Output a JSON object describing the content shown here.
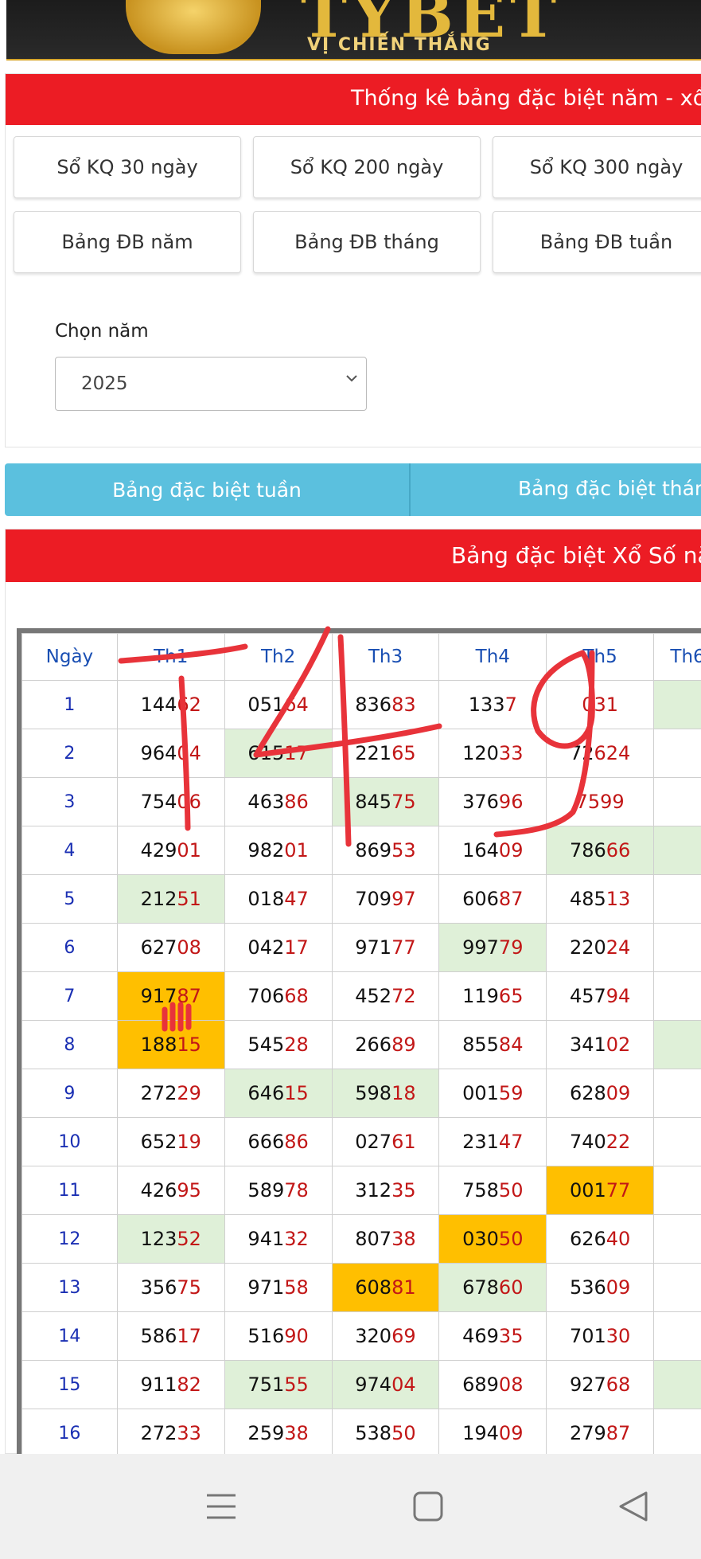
{
  "banner": {
    "brand": "TYBET",
    "tagline": "VỊ CHIẾN THẮNG"
  },
  "top_panel": {
    "title": "Thống kê bảng đặc biệt năm - xổ",
    "buttons": [
      "Sổ KQ 30 ngày",
      "Sổ KQ 200 ngày",
      "Sổ KQ 300 ngày",
      "Bảng ĐB năm",
      "Bảng ĐB tháng",
      "Bảng ĐB tuần"
    ],
    "year_label": "Chọn năm",
    "year_value": "2025"
  },
  "nav_tabs": {
    "week": "Bảng đặc biệt tuần",
    "month": "Bảng đặc biệt tháng"
  },
  "table_panel": {
    "title": "Bảng đặc biệt Xổ Số nă"
  },
  "table": {
    "headers": [
      "Ngày",
      "Th1",
      "Th2",
      "Th3",
      "Th4",
      "Th5",
      "Th6"
    ],
    "rows": [
      {
        "day": "1",
        "cells": [
          [
            "144",
            "62"
          ],
          [
            "051",
            "64"
          ],
          [
            "836",
            "83"
          ],
          [
            "133",
            "7"
          ],
          [
            "",
            "031"
          ]
        ]
      },
      {
        "day": "2",
        "cells": [
          [
            "964",
            "04"
          ],
          [
            "615",
            "17"
          ],
          [
            "221",
            "65"
          ],
          [
            "120",
            "33"
          ],
          [
            "72",
            "624"
          ]
        ]
      },
      {
        "day": "3",
        "cells": [
          [
            "754",
            "06"
          ],
          [
            "463",
            "86"
          ],
          [
            "845",
            "75"
          ],
          [
            "376",
            "96"
          ],
          [
            "",
            "7599"
          ]
        ]
      },
      {
        "day": "4",
        "cells": [
          [
            "429",
            "01"
          ],
          [
            "982",
            "01"
          ],
          [
            "869",
            "53"
          ],
          [
            "164",
            "09"
          ],
          [
            "786",
            "66"
          ]
        ]
      },
      {
        "day": "5",
        "cells": [
          [
            "212",
            "51"
          ],
          [
            "018",
            "47"
          ],
          [
            "709",
            "97"
          ],
          [
            "606",
            "87"
          ],
          [
            "485",
            "13"
          ]
        ]
      },
      {
        "day": "6",
        "cells": [
          [
            "627",
            "08"
          ],
          [
            "042",
            "17"
          ],
          [
            "971",
            "77"
          ],
          [
            "997",
            "79"
          ],
          [
            "220",
            "24"
          ]
        ]
      },
      {
        "day": "7",
        "cells": [
          [
            "917",
            "87"
          ],
          [
            "706",
            "68"
          ],
          [
            "452",
            "72"
          ],
          [
            "119",
            "65"
          ],
          [
            "457",
            "94"
          ]
        ]
      },
      {
        "day": "8",
        "cells": [
          [
            "188",
            "15"
          ],
          [
            "545",
            "28"
          ],
          [
            "266",
            "89"
          ],
          [
            "855",
            "84"
          ],
          [
            "341",
            "02"
          ]
        ]
      },
      {
        "day": "9",
        "cells": [
          [
            "272",
            "29"
          ],
          [
            "646",
            "15"
          ],
          [
            "598",
            "18"
          ],
          [
            "001",
            "59"
          ],
          [
            "628",
            "09"
          ]
        ]
      },
      {
        "day": "10",
        "cells": [
          [
            "652",
            "19"
          ],
          [
            "666",
            "86"
          ],
          [
            "027",
            "61"
          ],
          [
            "231",
            "47"
          ],
          [
            "740",
            "22"
          ]
        ]
      },
      {
        "day": "11",
        "cells": [
          [
            "426",
            "95"
          ],
          [
            "589",
            "78"
          ],
          [
            "312",
            "35"
          ],
          [
            "758",
            "50"
          ],
          [
            "001",
            "77"
          ]
        ]
      },
      {
        "day": "12",
        "cells": [
          [
            "123",
            "52"
          ],
          [
            "941",
            "32"
          ],
          [
            "807",
            "38"
          ],
          [
            "030",
            "50"
          ],
          [
            "626",
            "40"
          ]
        ]
      },
      {
        "day": "13",
        "cells": [
          [
            "356",
            "75"
          ],
          [
            "971",
            "58"
          ],
          [
            "608",
            "81"
          ],
          [
            "678",
            "60"
          ],
          [
            "536",
            "09"
          ]
        ]
      },
      {
        "day": "14",
        "cells": [
          [
            "586",
            "17"
          ],
          [
            "516",
            "90"
          ],
          [
            "320",
            "69"
          ],
          [
            "469",
            "35"
          ],
          [
            "701",
            "30"
          ]
        ]
      },
      {
        "day": "15",
        "cells": [
          [
            "911",
            "82"
          ],
          [
            "751",
            "55"
          ],
          [
            "974",
            "04"
          ],
          [
            "689",
            "08"
          ],
          [
            "927",
            "68"
          ]
        ]
      },
      {
        "day": "16",
        "cells": [
          [
            "272",
            "33"
          ],
          [
            "259",
            "38"
          ],
          [
            "538",
            "50"
          ],
          [
            "194",
            "09"
          ],
          [
            "279",
            "87"
          ]
        ]
      }
    ],
    "highlights": {
      "green": [
        [
          1,
          1
        ],
        [
          2,
          2
        ],
        [
          3,
          4
        ],
        [
          4,
          0
        ],
        [
          5,
          3
        ],
        [
          8,
          1
        ],
        [
          8,
          2
        ],
        [
          11,
          0
        ],
        [
          12,
          3
        ],
        [
          14,
          1
        ],
        [
          14,
          2
        ]
      ],
      "orange": [
        [
          6,
          0
        ],
        [
          7,
          0
        ],
        [
          10,
          4
        ],
        [
          11,
          3
        ],
        [
          12,
          2
        ]
      ],
      "th6_green_rows": [
        0,
        3,
        7,
        14
      ]
    },
    "colors": {
      "tail": "#c21717",
      "green": "#dff0d8",
      "orange": "#ffbf00",
      "header_text": "#1a4fb3"
    }
  },
  "annotation": {
    "handwritten": "149",
    "color": "#e8333a"
  },
  "android_nav": {
    "icons": [
      "menu-icon",
      "home-icon",
      "back-icon"
    ]
  }
}
